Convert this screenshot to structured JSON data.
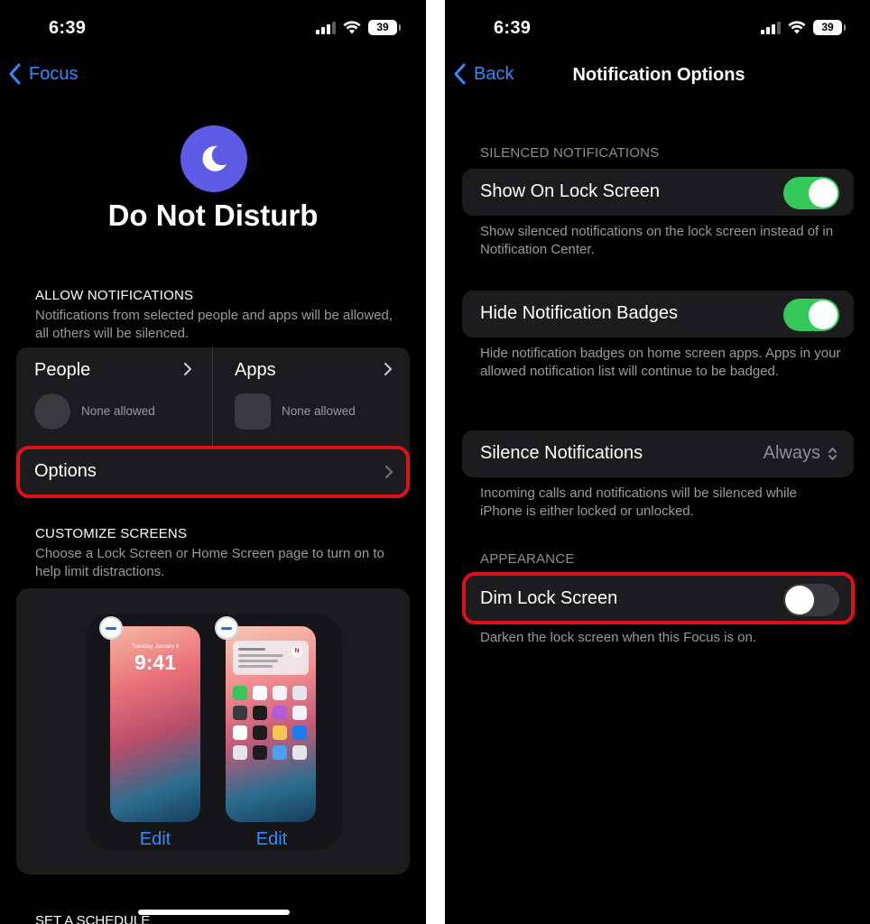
{
  "left_screen": {
    "status": {
      "time": "6:39",
      "battery": "39"
    },
    "nav": {
      "back_label": "Focus"
    },
    "focus": {
      "title": "Do Not Disturb",
      "icon": "moon-icon",
      "icon_color": "#5e5ce6"
    },
    "allow_notifications": {
      "header": "ALLOW NOTIFICATIONS",
      "description": "Notifications from selected people and apps will be allowed, all others will be silenced.",
      "people": {
        "label": "People",
        "status": "None allowed"
      },
      "apps": {
        "label": "Apps",
        "status": "None allowed"
      },
      "options_label": "Options"
    },
    "customize_screens": {
      "header": "CUSTOMIZE SCREENS",
      "description": "Choose a Lock Screen or Home Screen page to turn on to help limit distractions.",
      "lock_screen": {
        "date": "Tuesday, January 9",
        "time": "9:41",
        "edit_label": "Edit"
      },
      "home_screen": {
        "edit_label": "Edit"
      }
    },
    "schedule_header": "SET A SCHEDULE"
  },
  "right_screen": {
    "status": {
      "time": "6:39",
      "battery": "39"
    },
    "nav": {
      "back_label": "Back",
      "title": "Notification Options"
    },
    "silenced": {
      "header": "SILENCED NOTIFICATIONS",
      "show_on_lock": {
        "label": "Show On Lock Screen",
        "enabled": true
      },
      "show_on_lock_desc": "Show silenced notifications on the lock screen instead of in Notification Center.",
      "hide_badges": {
        "label": "Hide Notification Badges",
        "enabled": true
      },
      "hide_badges_desc": "Hide notification badges on home screen apps. Apps in your allowed notification list will continue to be badged.",
      "silence": {
        "label": "Silence Notifications",
        "value": "Always"
      },
      "silence_desc": "Incoming calls and notifications will be silenced while iPhone is either locked or unlocked."
    },
    "appearance": {
      "header": "APPEARANCE",
      "dim_lock": {
        "label": "Dim Lock Screen",
        "enabled": false
      },
      "dim_lock_desc": "Darken the lock screen when this Focus is on."
    }
  },
  "colors": {
    "accent": "#2f8cff",
    "toggle_on": "#34c759",
    "highlight": "#e0101a",
    "background": "#000000",
    "cell": "#1c1c1e"
  }
}
